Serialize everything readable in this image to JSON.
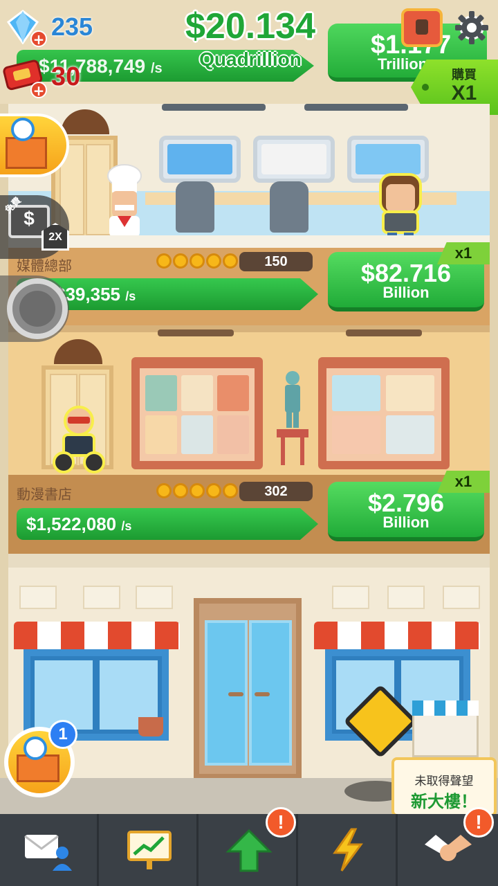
{
  "hud": {
    "gems": "235",
    "tickets": "30",
    "income_rate": "$11,788,749",
    "income_rate_unit": "/s",
    "total_money": "$20.134",
    "total_money_unit": "Quadrillion",
    "top_upgrade_value": "$1.177",
    "top_upgrade_unit": "Trillion",
    "buy_label": "購買",
    "buy_multiplier": "X1"
  },
  "side": {
    "free_label": "免費",
    "tv_multiplier": "2X",
    "lobby_badge_count": "1"
  },
  "floors": [
    {
      "name": "媒體總部",
      "stars_filled": 5,
      "level": "150",
      "income": "$39,355",
      "income_unit": "/s",
      "upgrade_value": "$82.716",
      "upgrade_unit": "Billion",
      "multiplier": "x1"
    },
    {
      "name": "動漫書店",
      "stars_filled": 5,
      "level": "302",
      "income": "$1,522,080",
      "income_unit": "/s",
      "upgrade_value": "$2.796",
      "upgrade_unit": "Billion",
      "multiplier": "x1"
    }
  ],
  "lobby": {
    "new_building_line1": "未取得聲望",
    "new_building_line2": "新大樓！"
  },
  "nav": {
    "items": [
      {
        "icon": "mail-people-icon",
        "alert": ""
      },
      {
        "icon": "stats-board-icon",
        "alert": ""
      },
      {
        "icon": "upgrade-arrow-icon",
        "alert": "!"
      },
      {
        "icon": "lightning-boost-icon",
        "alert": ""
      },
      {
        "icon": "handshake-icon",
        "alert": "!"
      }
    ]
  },
  "colors": {
    "accent_green": "#1fa637",
    "gem_blue": "#2a86d6",
    "ticket_red": "#c81b1b",
    "nav_bg": "#3a4046"
  }
}
